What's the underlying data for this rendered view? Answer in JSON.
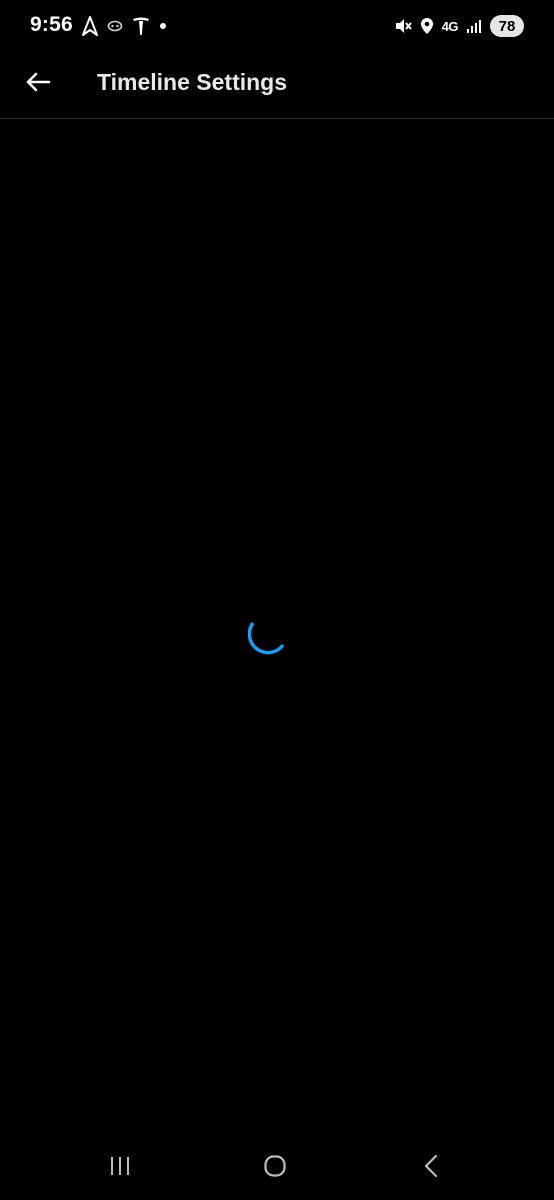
{
  "status_bar": {
    "time": "9:56",
    "left_icons": [
      "navigation-arrow-icon",
      "game-controller-icon",
      "tesla-icon",
      "notification-dot-icon"
    ],
    "right_icons": [
      "mute-icon",
      "location-icon",
      "network-4g-icon",
      "signal-icon"
    ],
    "network": "4G",
    "battery": "78"
  },
  "header": {
    "title": "Timeline Settings",
    "back_icon": "back-arrow-icon"
  },
  "content": {
    "loading": true,
    "spinner_color": "#1d9bf0"
  },
  "nav_bar": {
    "icons": [
      "recents-icon",
      "home-icon",
      "back-icon"
    ]
  },
  "colors": {
    "background": "#000000",
    "divider": "#2f3336",
    "accent": "#1d9bf0"
  }
}
